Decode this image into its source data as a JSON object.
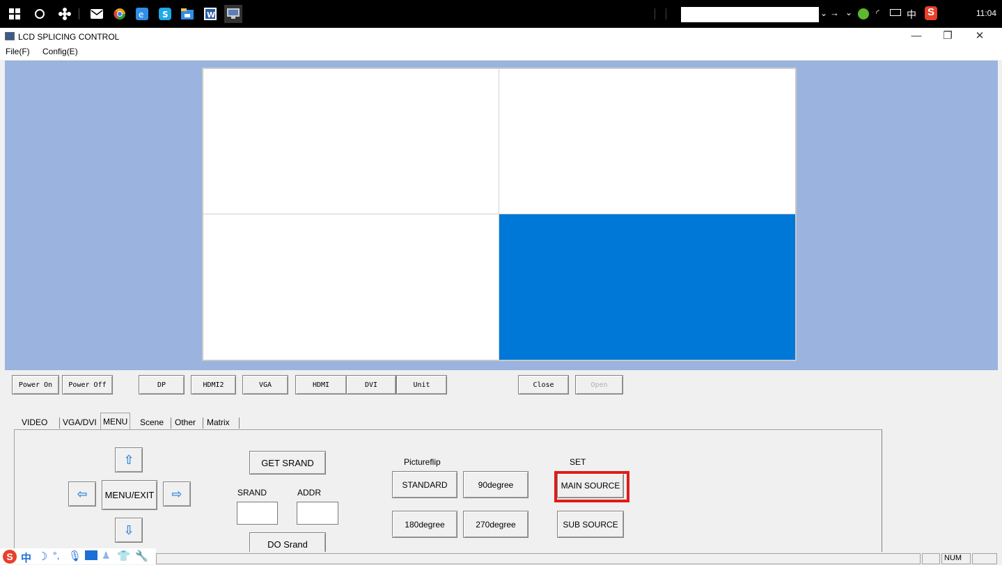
{
  "taskbar": {
    "clock": "11:04",
    "tray_ime": "中",
    "icons": [
      "start-icon",
      "cortana-icon",
      "fan-app-icon",
      "mail-icon",
      "chrome-icon",
      "browser-icon",
      "skype-icon",
      "file-explorer-icon",
      "word-icon",
      "lcd-app-icon"
    ]
  },
  "window": {
    "title": "LCD SPLICING CONTROL",
    "minimize": "—",
    "restore": "❐",
    "close": "✕"
  },
  "menu": {
    "file": "File(F)",
    "config": "Config(E)"
  },
  "wall": {
    "selected_cell": 4,
    "cells": 4,
    "colors": {
      "background": "#9ab3df",
      "selected": "#0078d7"
    }
  },
  "toolbar": {
    "power_on": "Power On",
    "power_off": "Power Off",
    "dp": "DP",
    "hdmi2": "HDMI2",
    "vga": "VGA",
    "hdmi": "HDMI",
    "dvi": "DVI",
    "unit": "Unit",
    "close": "Close",
    "open": "Open"
  },
  "tabs": [
    "VIDEO",
    "VGA/DVI",
    "MENU",
    "Scene",
    "Other",
    "Matrix"
  ],
  "active_tab": "MENU",
  "menu_panel": {
    "up": "⇧",
    "left": "⇦",
    "right": "⇨",
    "down": "⇩",
    "menu_exit": "MENU/EXIT",
    "get_srand": "GET SRAND",
    "srand_label": "SRAND",
    "addr_label": "ADDR",
    "srand_value": "",
    "addr_value": "",
    "do_srand": "DO Srand",
    "pictureflip_label": "Pictureflip",
    "standard": "STANDARD",
    "deg90": "90degree",
    "deg180": "180degree",
    "deg270": "270degree",
    "set_label": "SET",
    "main_source": "MAIN SOURCE",
    "sub_source": "SUB SOURCE"
  },
  "statusbar": {
    "num": "NUM",
    "ime_mode": "中"
  }
}
